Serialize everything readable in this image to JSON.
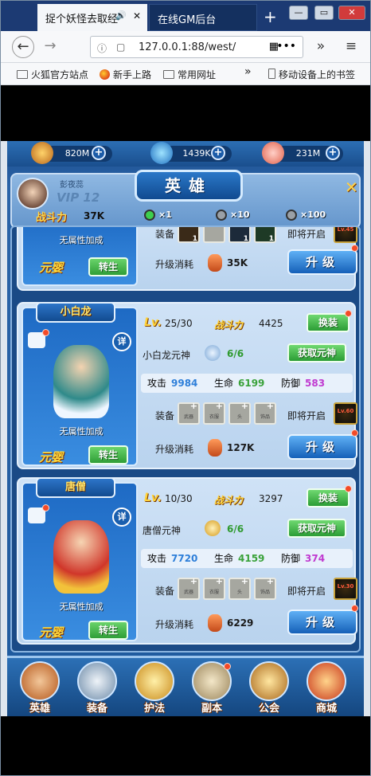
{
  "browser": {
    "tabs": [
      {
        "label": "捉个妖怪去取经",
        "speaker": "🔊",
        "close": "✕"
      },
      {
        "label": "在线GM后台"
      }
    ],
    "new_tab": "+",
    "url": "127.0.0.1:88/west/",
    "bookmarks": [
      "火狐官方站点",
      "新手上路",
      "常用网址",
      "移动设备上的书签"
    ],
    "bookmarks_more": "»"
  },
  "game": {
    "resources": [
      {
        "name": "gold",
        "value": "820M",
        "color": "#d9902a"
      },
      {
        "name": "gem",
        "value": "1439K",
        "color": "#3aa2e0"
      },
      {
        "name": "peach",
        "value": "231M",
        "color": "#f08a8a"
      }
    ],
    "player": {
      "nickname": "彭夜蕊",
      "vip": "VIP 12",
      "power_label": "战斗力",
      "power": "37K"
    },
    "title": "英雄",
    "gems": [
      {
        "text": "×1",
        "color": "#3dcf4e"
      },
      {
        "text": "×10",
        "color": "#9aa0a6"
      },
      {
        "text": "×100",
        "color": "#9aa0a6"
      }
    ],
    "top_card": {
      "attr": "无属性加成",
      "yuanying": "元婴",
      "zhuansheng": "转生",
      "equip_label": "装备",
      "unlock_label": "即将开启",
      "unlock_level": "Lv.45",
      "cost_label": "升级消耗",
      "cost": "35K",
      "upgrade": "升级",
      "slot_counts": [
        "1",
        "",
        "1",
        "1"
      ]
    },
    "heroes": [
      {
        "name": "小白龙",
        "detail": "详",
        "attr": "无属性加成",
        "yuanying": "元婴",
        "zhuansheng": "转生",
        "lv_label": "Lv.",
        "level": "25/30",
        "cp_label": "战斗力",
        "cp": "4425",
        "change": "换装",
        "spirit_label": "小白龙元神",
        "spirit_count": "6/6",
        "get_spirit": "获取元神",
        "atk_label": "攻击",
        "atk": "9984",
        "hp_label": "生命",
        "hp": "6199",
        "def_label": "防御",
        "def": "583",
        "equip_label": "装备",
        "slots": [
          "武器",
          "衣服",
          "头",
          "饰品"
        ],
        "unlock_label": "即将开启",
        "unlock_level": "Lv.60",
        "cost_label": "升级消耗",
        "cost": "127K",
        "upgrade": "升级"
      },
      {
        "name": "唐僧",
        "detail": "详",
        "attr": "无属性加成",
        "yuanying": "元婴",
        "zhuansheng": "转生",
        "lv_label": "Lv.",
        "level": "10/30",
        "cp_label": "战斗力",
        "cp": "3297",
        "change": "换装",
        "spirit_label": "唐僧元神",
        "spirit_count": "6/6",
        "get_spirit": "获取元神",
        "atk_label": "攻击",
        "atk": "7720",
        "hp_label": "生命",
        "hp": "4159",
        "def_label": "防御",
        "def": "374",
        "equip_label": "装备",
        "slots": [
          "武器",
          "衣服",
          "头",
          "饰品"
        ],
        "unlock_label": "即将开启",
        "unlock_level": "Lv.30",
        "cost_label": "升级消耗",
        "cost": "6229",
        "upgrade": "升级"
      }
    ],
    "nav": [
      {
        "label": "英雄",
        "color": "#e0873a"
      },
      {
        "label": "装备",
        "color": "#c9d4df"
      },
      {
        "label": "护法",
        "color": "#e7b23a"
      },
      {
        "label": "副本",
        "color": "#d6c39a"
      },
      {
        "label": "公会",
        "color": "#d9a23a"
      },
      {
        "label": "商城",
        "color": "#e0552c"
      }
    ],
    "stat_colors": {
      "atk": "#2e7fd9",
      "hp": "#3aa23a",
      "def": "#c03ad0"
    }
  }
}
